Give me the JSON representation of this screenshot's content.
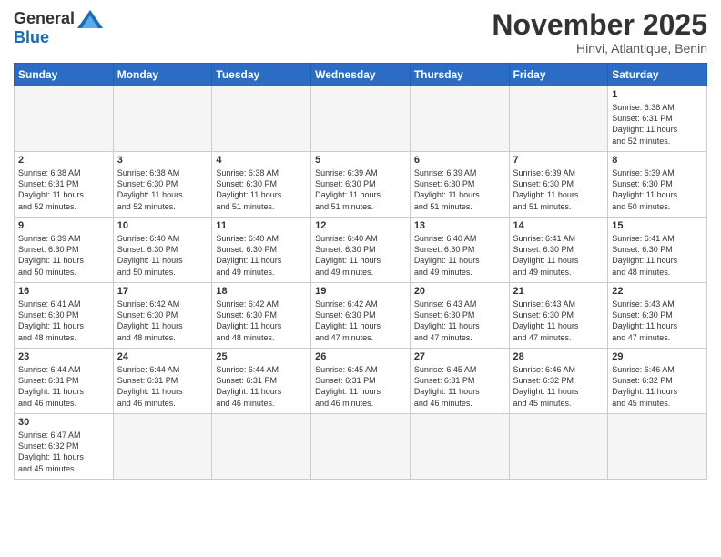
{
  "logo": {
    "general": "General",
    "blue": "Blue"
  },
  "header": {
    "month": "November 2025",
    "location": "Hinvi, Atlantique, Benin"
  },
  "weekdays": [
    "Sunday",
    "Monday",
    "Tuesday",
    "Wednesday",
    "Thursday",
    "Friday",
    "Saturday"
  ],
  "weeks": [
    [
      {
        "day": "",
        "info": ""
      },
      {
        "day": "",
        "info": ""
      },
      {
        "day": "",
        "info": ""
      },
      {
        "day": "",
        "info": ""
      },
      {
        "day": "",
        "info": ""
      },
      {
        "day": "",
        "info": ""
      },
      {
        "day": "1",
        "info": "Sunrise: 6:38 AM\nSunset: 6:31 PM\nDaylight: 11 hours\nand 52 minutes."
      }
    ],
    [
      {
        "day": "2",
        "info": "Sunrise: 6:38 AM\nSunset: 6:31 PM\nDaylight: 11 hours\nand 52 minutes."
      },
      {
        "day": "3",
        "info": "Sunrise: 6:38 AM\nSunset: 6:30 PM\nDaylight: 11 hours\nand 52 minutes."
      },
      {
        "day": "4",
        "info": "Sunrise: 6:38 AM\nSunset: 6:30 PM\nDaylight: 11 hours\nand 51 minutes."
      },
      {
        "day": "5",
        "info": "Sunrise: 6:39 AM\nSunset: 6:30 PM\nDaylight: 11 hours\nand 51 minutes."
      },
      {
        "day": "6",
        "info": "Sunrise: 6:39 AM\nSunset: 6:30 PM\nDaylight: 11 hours\nand 51 minutes."
      },
      {
        "day": "7",
        "info": "Sunrise: 6:39 AM\nSunset: 6:30 PM\nDaylight: 11 hours\nand 51 minutes."
      },
      {
        "day": "8",
        "info": "Sunrise: 6:39 AM\nSunset: 6:30 PM\nDaylight: 11 hours\nand 50 minutes."
      }
    ],
    [
      {
        "day": "9",
        "info": "Sunrise: 6:39 AM\nSunset: 6:30 PM\nDaylight: 11 hours\nand 50 minutes."
      },
      {
        "day": "10",
        "info": "Sunrise: 6:40 AM\nSunset: 6:30 PM\nDaylight: 11 hours\nand 50 minutes."
      },
      {
        "day": "11",
        "info": "Sunrise: 6:40 AM\nSunset: 6:30 PM\nDaylight: 11 hours\nand 49 minutes."
      },
      {
        "day": "12",
        "info": "Sunrise: 6:40 AM\nSunset: 6:30 PM\nDaylight: 11 hours\nand 49 minutes."
      },
      {
        "day": "13",
        "info": "Sunrise: 6:40 AM\nSunset: 6:30 PM\nDaylight: 11 hours\nand 49 minutes."
      },
      {
        "day": "14",
        "info": "Sunrise: 6:41 AM\nSunset: 6:30 PM\nDaylight: 11 hours\nand 49 minutes."
      },
      {
        "day": "15",
        "info": "Sunrise: 6:41 AM\nSunset: 6:30 PM\nDaylight: 11 hours\nand 48 minutes."
      }
    ],
    [
      {
        "day": "16",
        "info": "Sunrise: 6:41 AM\nSunset: 6:30 PM\nDaylight: 11 hours\nand 48 minutes."
      },
      {
        "day": "17",
        "info": "Sunrise: 6:42 AM\nSunset: 6:30 PM\nDaylight: 11 hours\nand 48 minutes."
      },
      {
        "day": "18",
        "info": "Sunrise: 6:42 AM\nSunset: 6:30 PM\nDaylight: 11 hours\nand 48 minutes."
      },
      {
        "day": "19",
        "info": "Sunrise: 6:42 AM\nSunset: 6:30 PM\nDaylight: 11 hours\nand 47 minutes."
      },
      {
        "day": "20",
        "info": "Sunrise: 6:43 AM\nSunset: 6:30 PM\nDaylight: 11 hours\nand 47 minutes."
      },
      {
        "day": "21",
        "info": "Sunrise: 6:43 AM\nSunset: 6:30 PM\nDaylight: 11 hours\nand 47 minutes."
      },
      {
        "day": "22",
        "info": "Sunrise: 6:43 AM\nSunset: 6:30 PM\nDaylight: 11 hours\nand 47 minutes."
      }
    ],
    [
      {
        "day": "23",
        "info": "Sunrise: 6:44 AM\nSunset: 6:31 PM\nDaylight: 11 hours\nand 46 minutes."
      },
      {
        "day": "24",
        "info": "Sunrise: 6:44 AM\nSunset: 6:31 PM\nDaylight: 11 hours\nand 46 minutes."
      },
      {
        "day": "25",
        "info": "Sunrise: 6:44 AM\nSunset: 6:31 PM\nDaylight: 11 hours\nand 46 minutes."
      },
      {
        "day": "26",
        "info": "Sunrise: 6:45 AM\nSunset: 6:31 PM\nDaylight: 11 hours\nand 46 minutes."
      },
      {
        "day": "27",
        "info": "Sunrise: 6:45 AM\nSunset: 6:31 PM\nDaylight: 11 hours\nand 46 minutes."
      },
      {
        "day": "28",
        "info": "Sunrise: 6:46 AM\nSunset: 6:32 PM\nDaylight: 11 hours\nand 45 minutes."
      },
      {
        "day": "29",
        "info": "Sunrise: 6:46 AM\nSunset: 6:32 PM\nDaylight: 11 hours\nand 45 minutes."
      }
    ],
    [
      {
        "day": "30",
        "info": "Sunrise: 6:47 AM\nSunset: 6:32 PM\nDaylight: 11 hours\nand 45 minutes."
      },
      {
        "day": "",
        "info": ""
      },
      {
        "day": "",
        "info": ""
      },
      {
        "day": "",
        "info": ""
      },
      {
        "day": "",
        "info": ""
      },
      {
        "day": "",
        "info": ""
      },
      {
        "day": "",
        "info": ""
      }
    ]
  ]
}
